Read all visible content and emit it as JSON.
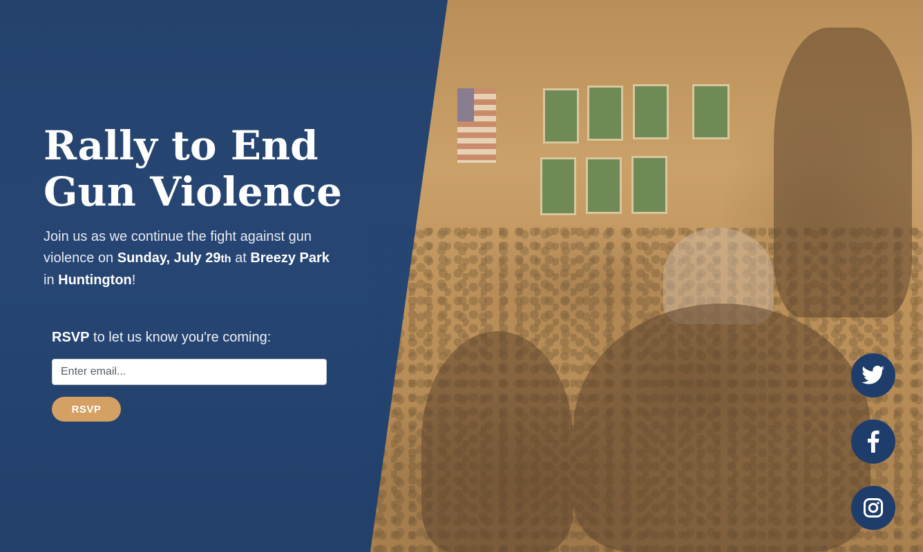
{
  "hero": {
    "title_line1": "Rally to End",
    "title_line2": "Gun Violence",
    "desc_intro": "Join us as we continue the fight against gun violence on ",
    "date": "Sunday, July 29",
    "date_suffix": "th",
    "at": " at ",
    "venue": "Breezy Park",
    "in": " in ",
    "city": "Huntington",
    "end": "!"
  },
  "rsvp": {
    "prompt_bold": "RSVP",
    "prompt_rest": " to let us know you're coming:",
    "email_placeholder": "Enter email...",
    "button_label": "RSVP"
  },
  "social": [
    {
      "name": "twitter",
      "icon": "twitter-icon"
    },
    {
      "name": "facebook",
      "icon": "facebook-icon"
    },
    {
      "name": "instagram",
      "icon": "instagram-icon"
    }
  ],
  "colors": {
    "panel_blue": "#1f4274",
    "accent_gold": "#d4a064",
    "photo_tint": "#c79a5a",
    "social_bg": "#1f3d6b"
  }
}
